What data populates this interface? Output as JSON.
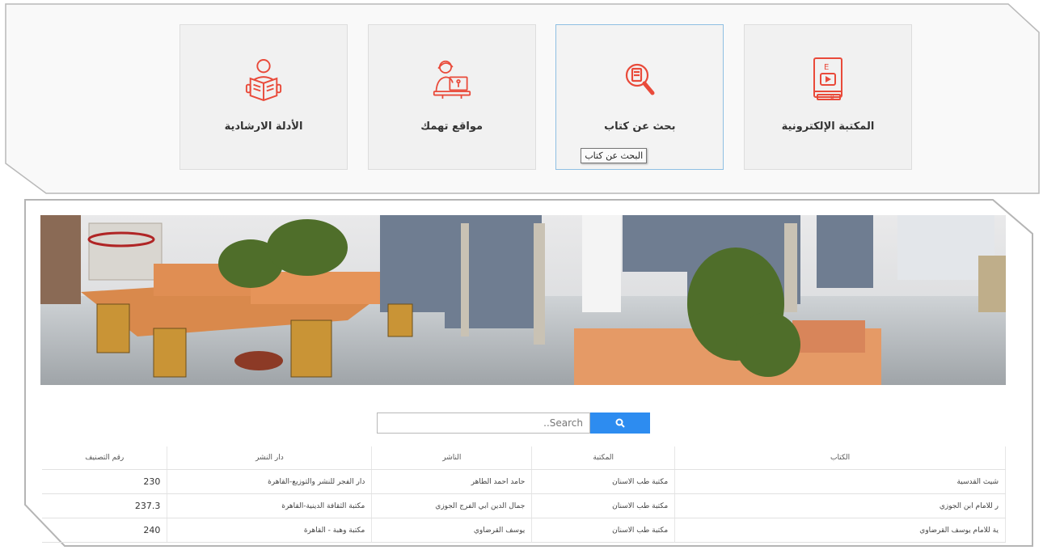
{
  "tiles": [
    {
      "label": "المكتبة الإلكترونية",
      "icon": "ebook-icon"
    },
    {
      "label": "بحث عن كتاب",
      "icon": "book-search-icon",
      "tooltip": "البحث عن كتاب"
    },
    {
      "label": "مواقع تهمك",
      "icon": "person-computer-icon"
    },
    {
      "label": "الأدلة الارشادية",
      "icon": "reading-person-icon"
    }
  ],
  "search": {
    "placeholder": "..Search",
    "button_icon": "search-icon"
  },
  "table": {
    "headers": [
      "الكتاب",
      "المكتبة",
      "الناشر",
      "دار النشر",
      "رقم التصنيف"
    ],
    "rows": [
      [
        "شيث القدسية",
        "مكتبة طب الاسنان",
        "حامد احمد الطاهر",
        "دار الفجر للنشر والتوزيع-القاهرة",
        "230"
      ],
      [
        "ر للامام ابن الجوزي",
        "مكتبة طب الاسنان",
        "جمال الدين ابي الفرج الجوزي",
        "مكتبة الثقافة الدينية-القاهرة",
        "237.3"
      ],
      [
        "ية للامام يوسف القرضاوي",
        "مكتبة طب الاسنان",
        "يوسف القرضاوي",
        "مكتبة وهبة - القاهرة",
        "240"
      ]
    ]
  },
  "colors": {
    "accent": "#e94a3a",
    "search_button": "#2d8cf0",
    "active_border": "#8fbfe3"
  }
}
